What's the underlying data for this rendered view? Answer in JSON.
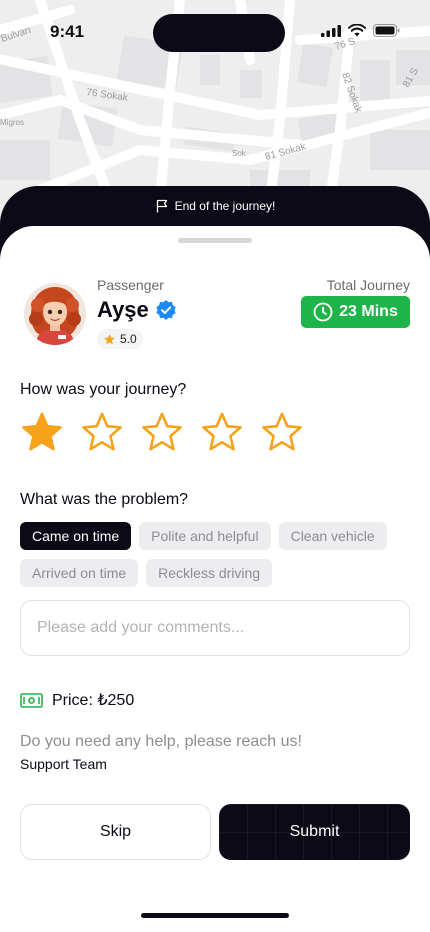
{
  "status_bar": {
    "time": "9:41"
  },
  "map": {
    "labels": [
      "Bulvarı",
      "76 Sokak",
      "82 Sokak",
      "81 Sokak",
      "Sok",
      "Migros",
      "76 S",
      "81 S"
    ]
  },
  "banner": {
    "text": "End of the journey!",
    "icon": "flag-icon"
  },
  "passenger": {
    "label": "Passenger",
    "name": "Ayşe",
    "verified": true,
    "rating": "5.0"
  },
  "journey": {
    "total_label": "Total Journey",
    "duration": "23 Mins",
    "badge_color": "#1fb44a"
  },
  "rating_section": {
    "question": "How was your journey?",
    "max_stars": 5,
    "selected_stars": 1,
    "star_color": "#f7a21b"
  },
  "problem_section": {
    "question": "What was the problem?",
    "chips": [
      {
        "label": "Came on time",
        "active": true
      },
      {
        "label": "Polite and helpful",
        "active": false
      },
      {
        "label": "Clean vehicle",
        "active": false
      },
      {
        "label": "Arrived on time",
        "active": false
      },
      {
        "label": "Reckless driving",
        "active": false
      }
    ]
  },
  "comment": {
    "placeholder": "Please add your comments...",
    "value": ""
  },
  "price": {
    "label": "Price: ₺250",
    "icon": "cash-icon",
    "icon_color": "#1fb44a"
  },
  "help": {
    "text": "Do you need any help, please reach us!",
    "link": "Support Team"
  },
  "actions": {
    "skip_label": "Skip",
    "submit_label": "Submit"
  }
}
